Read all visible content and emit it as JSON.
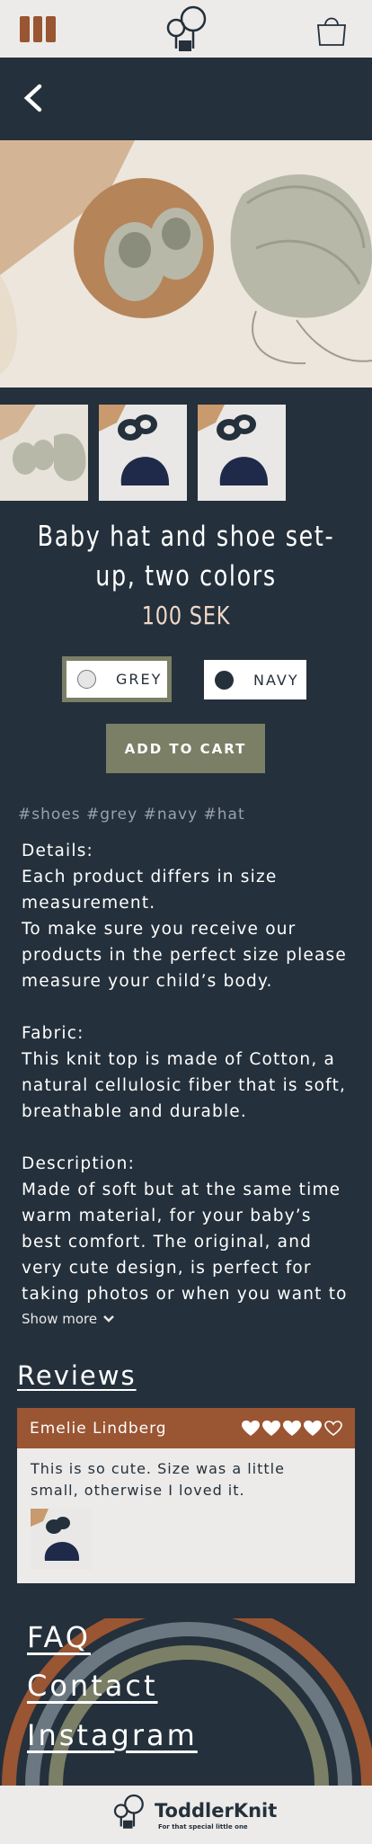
{
  "header": {
    "menu_icon": "hamburger-icon",
    "logo_icon": "tree-logo-icon",
    "cart_icon": "shopping-bag-icon",
    "back_icon": "chevron-left-icon"
  },
  "product": {
    "title": "Baby hat and shoe set-up, two colors",
    "price": "100 SEK",
    "colors": [
      {
        "label": "GREY",
        "swatch": "#e6e6e6",
        "selected": true
      },
      {
        "label": "NAVY",
        "swatch": "#24303b",
        "selected": false
      }
    ],
    "add_to_cart": "ADD TO CART",
    "tags": "#shoes #grey #navy #hat",
    "details": "Details:\nEach product differs in size measurement.\nTo make sure you receive our products in the perfect size please measure your child’s body.\n\nFabric:\nThis knit top is made of Cotton, a natural cellulosic fiber that is soft, breathable and durable.\n\nDescription:\nMade of soft but at the same time warm material, for your baby’s best comfort. The original, and very cute design, is perfect for taking photos or when you want to dress up the",
    "show_more": "Show more"
  },
  "reviews": {
    "heading": "Reviews",
    "items": [
      {
        "name": "Emelie Lindberg",
        "rating": 4,
        "max": 5,
        "text": "This is so cute. Size was a little small, otherwise I loved it."
      }
    ]
  },
  "footer": {
    "links": [
      "FAQ",
      "Contact",
      "Instagram"
    ],
    "brand": "ToddlerKnit",
    "tagline": "For that special little one"
  },
  "colors": {
    "navy": "#24303b",
    "rust": "#9a5532",
    "olive": "#7a7f66",
    "light": "#ecebea"
  }
}
